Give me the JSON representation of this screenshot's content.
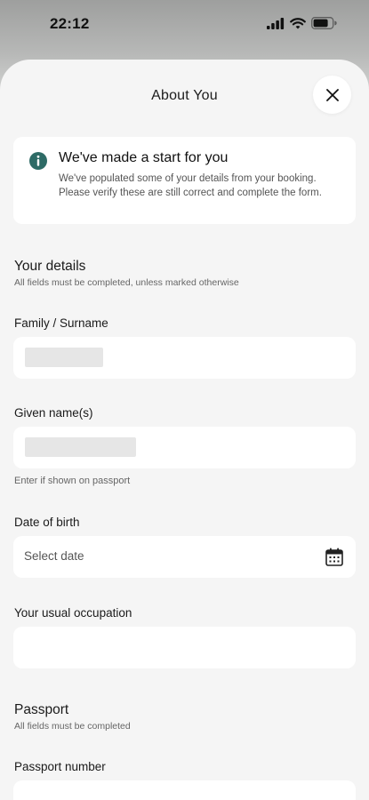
{
  "status_bar": {
    "time": "22:12"
  },
  "sheet": {
    "title": "About You",
    "close_icon": "close-icon"
  },
  "info_card": {
    "icon": "info-icon",
    "title": "We've made a start for you",
    "body": "We've populated some of your details from your booking. Please verify these are still correct and complete the form."
  },
  "your_details": {
    "heading": "Your details",
    "subheading": "All fields must be completed, unless marked otherwise",
    "fields": {
      "surname": {
        "label": "Family / Surname",
        "value": ""
      },
      "given_names": {
        "label": "Given name(s)",
        "value": "",
        "hint": "Enter if shown on passport"
      },
      "dob": {
        "label": "Date of birth",
        "placeholder": "Select date",
        "icon": "calendar-icon"
      },
      "occupation": {
        "label": "Your usual occupation",
        "value": ""
      }
    }
  },
  "passport": {
    "heading": "Passport",
    "subheading": "All fields must be completed",
    "fields": {
      "number": {
        "label": "Passport number",
        "value": ""
      }
    }
  },
  "colors": {
    "info_icon": "#2e6b66",
    "sheet_bg": "#f5f5f5",
    "field_bg": "#ffffff"
  }
}
